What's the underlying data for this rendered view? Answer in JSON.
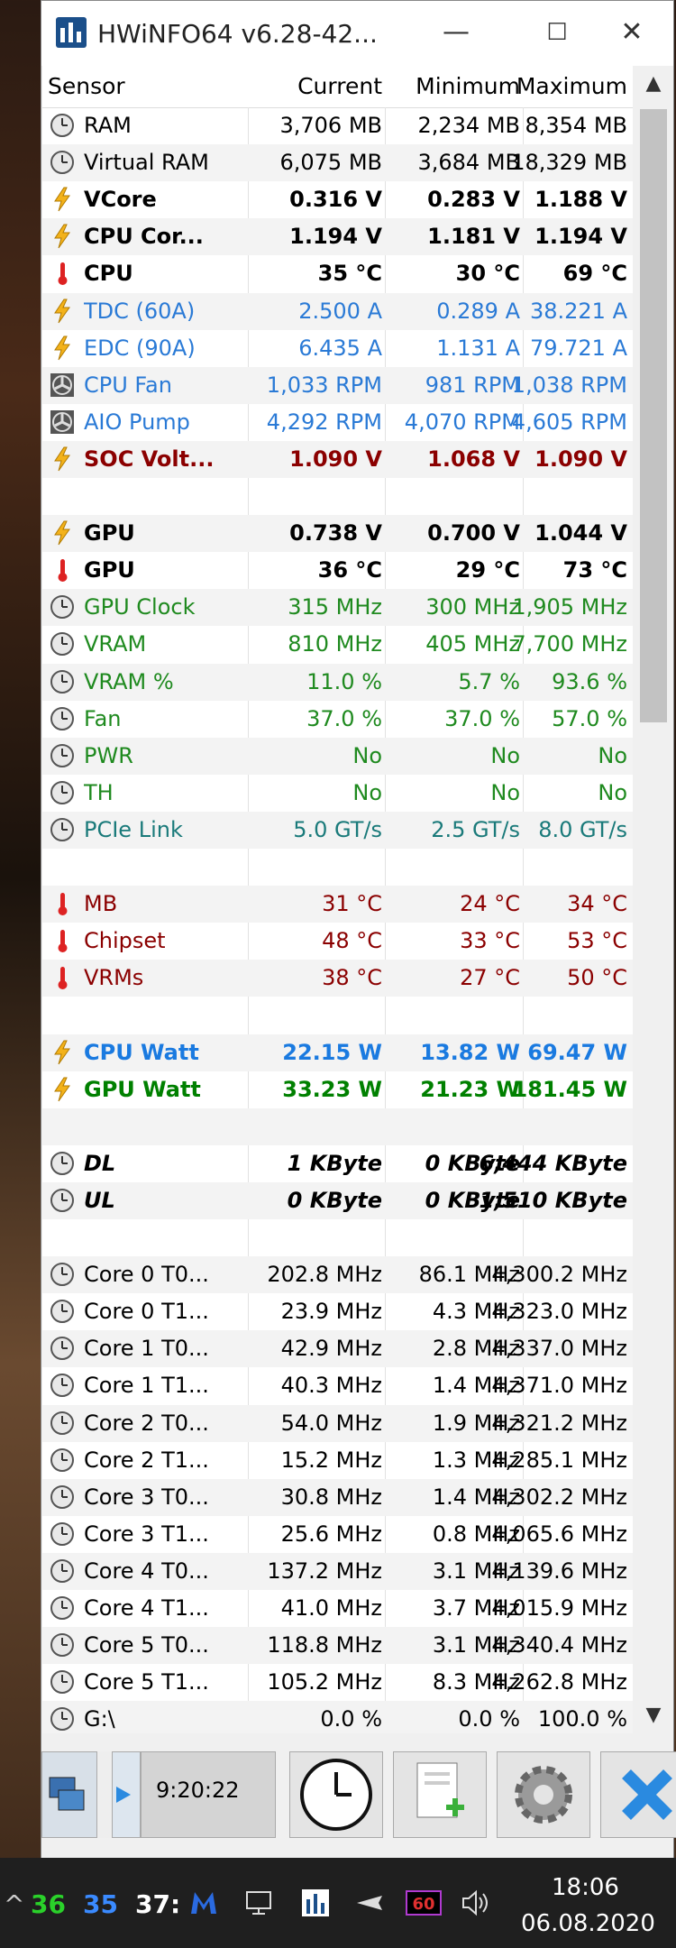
{
  "window": {
    "title": "HWiNFO64 v6.28-42...",
    "minimize": "—",
    "maximize": "☐",
    "close": "✕"
  },
  "header": {
    "sensor": "Sensor",
    "current": "Current",
    "minimum": "Minimum",
    "maximum": "Maximum"
  },
  "colors": {
    "blue": "#1a6fd6",
    "darkred": "#8b0000",
    "green": "#008000",
    "lightblue": "#2a8ae0",
    "teal": "#1a7a7a"
  },
  "rows": [
    {
      "name": "RAM",
      "cur": "3,706 MB",
      "min": "2,234 MB",
      "max": "8,354 MB",
      "icon": "clock-icon",
      "style": "",
      "color": "#000000"
    },
    {
      "name": "Virtual RAM",
      "cur": "6,075 MB",
      "min": "3,684 MB",
      "max": "18,329 MB",
      "icon": "clock-icon",
      "style": "",
      "color": "#000000"
    },
    {
      "name": "VCore",
      "cur": "0.316 V",
      "min": "0.283 V",
      "max": "1.188 V",
      "icon": "lightning-icon",
      "style": "bold",
      "color": "#000000"
    },
    {
      "name": "CPU Cor...",
      "cur": "1.194 V",
      "min": "1.181 V",
      "max": "1.194 V",
      "icon": "lightning-icon",
      "style": "bold",
      "color": "#000000"
    },
    {
      "name": "CPU",
      "cur": "35 °C",
      "min": "30 °C",
      "max": "69 °C",
      "icon": "thermometer-icon",
      "style": "bold",
      "color": "#000000"
    },
    {
      "name": "TDC (60A)",
      "cur": "2.500 A",
      "min": "0.289 A",
      "max": "38.221 A",
      "icon": "lightning-icon",
      "style": "",
      "color": "#2a7ad6"
    },
    {
      "name": "EDC (90A)",
      "cur": "6.435 A",
      "min": "1.131 A",
      "max": "79.721 A",
      "icon": "lightning-icon",
      "style": "",
      "color": "#2a7ad6"
    },
    {
      "name": "CPU Fan",
      "cur": "1,033 RPM",
      "min": "981 RPM",
      "max": "1,038 RPM",
      "icon": "fan-icon",
      "style": "",
      "color": "#2a7ad6"
    },
    {
      "name": "AIO Pump",
      "cur": "4,292 RPM",
      "min": "4,070 RPM",
      "max": "4,605 RPM",
      "icon": "fan-icon",
      "style": "",
      "color": "#2a7ad6"
    },
    {
      "name": "SOC Volt...",
      "cur": "1.090 V",
      "min": "1.068 V",
      "max": "1.090 V",
      "icon": "lightning-icon",
      "style": "bold",
      "color": "#8b0000"
    },
    {
      "name": "",
      "cur": "",
      "min": "",
      "max": "",
      "icon": "",
      "style": "",
      "color": "#000000"
    },
    {
      "name": "GPU",
      "cur": "0.738 V",
      "min": "0.700 V",
      "max": "1.044 V",
      "icon": "lightning-icon",
      "style": "bold",
      "color": "#000000"
    },
    {
      "name": "GPU",
      "cur": "36 °C",
      "min": "29 °C",
      "max": "73 °C",
      "icon": "thermometer-icon",
      "style": "bold",
      "color": "#000000"
    },
    {
      "name": "GPU Clock",
      "cur": "315 MHz",
      "min": "300 MHz",
      "max": "1,905 MHz",
      "icon": "clock-icon",
      "style": "",
      "color": "#1f8a1f"
    },
    {
      "name": "VRAM",
      "cur": "810 MHz",
      "min": "405 MHz",
      "max": "7,700 MHz",
      "icon": "clock-icon",
      "style": "",
      "color": "#1f8a1f"
    },
    {
      "name": "VRAM %",
      "cur": "11.0 %",
      "min": "5.7 %",
      "max": "93.6 %",
      "icon": "clock-icon",
      "style": "",
      "color": "#1f8a1f"
    },
    {
      "name": "Fan",
      "cur": "37.0 %",
      "min": "37.0 %",
      "max": "57.0 %",
      "icon": "clock-icon",
      "style": "",
      "color": "#1f8a1f"
    },
    {
      "name": "PWR",
      "cur": "No",
      "min": "No",
      "max": "No",
      "icon": "clock-icon",
      "style": "",
      "color": "#1f8a1f"
    },
    {
      "name": "TH",
      "cur": "No",
      "min": "No",
      "max": "No",
      "icon": "clock-icon",
      "style": "",
      "color": "#1f8a1f"
    },
    {
      "name": "PCIe Link",
      "cur": "5.0 GT/s",
      "min": "2.5 GT/s",
      "max": "8.0 GT/s",
      "icon": "clock-icon",
      "style": "",
      "color": "#1a7a7a"
    },
    {
      "name": "",
      "cur": "",
      "min": "",
      "max": "",
      "icon": "",
      "style": "",
      "color": "#000000"
    },
    {
      "name": "MB",
      "cur": "31 °C",
      "min": "24 °C",
      "max": "34 °C",
      "icon": "thermometer-icon",
      "style": "",
      "color": "#8b0000"
    },
    {
      "name": "Chipset",
      "cur": "48 °C",
      "min": "33 °C",
      "max": "53 °C",
      "icon": "thermometer-icon",
      "style": "",
      "color": "#8b0000"
    },
    {
      "name": "VRMs",
      "cur": "38 °C",
      "min": "27 °C",
      "max": "50 °C",
      "icon": "thermometer-icon",
      "style": "",
      "color": "#8b0000"
    },
    {
      "name": "",
      "cur": "",
      "min": "",
      "max": "",
      "icon": "",
      "style": "",
      "color": "#000000"
    },
    {
      "name": "CPU Watt",
      "cur": "22.15 W",
      "min": "13.82 W",
      "max": "69.47 W",
      "icon": "lightning-icon",
      "style": "bold",
      "color": "#1a7ae0"
    },
    {
      "name": "GPU Watt",
      "cur": "33.23 W",
      "min": "21.23 W",
      "max": "181.45 W",
      "icon": "lightning-icon",
      "style": "bold",
      "color": "#008000"
    },
    {
      "name": "",
      "cur": "",
      "min": "",
      "max": "",
      "icon": "",
      "style": "",
      "color": "#000000"
    },
    {
      "name": "DL",
      "cur": "1 KByte",
      "min": "0 KByte",
      "max": "6,444 KByte",
      "icon": "clock-icon",
      "style": "bolditalic",
      "color": "#000000"
    },
    {
      "name": "UL",
      "cur": "0 KByte",
      "min": "0 KByte",
      "max": "1,510 KByte",
      "icon": "clock-icon",
      "style": "bolditalic",
      "color": "#000000"
    },
    {
      "name": "",
      "cur": "",
      "min": "",
      "max": "",
      "icon": "",
      "style": "",
      "color": "#000000"
    },
    {
      "name": "Core 0 T0...",
      "cur": "202.8 MHz",
      "min": "86.1 MHz",
      "max": "4,300.2 MHz",
      "icon": "clock-icon",
      "style": "",
      "color": "#000000"
    },
    {
      "name": "Core 0 T1...",
      "cur": "23.9 MHz",
      "min": "4.3 MHz",
      "max": "4,323.0 MHz",
      "icon": "clock-icon",
      "style": "",
      "color": "#000000"
    },
    {
      "name": "Core 1 T0...",
      "cur": "42.9 MHz",
      "min": "2.8 MHz",
      "max": "4,337.0 MHz",
      "icon": "clock-icon",
      "style": "",
      "color": "#000000"
    },
    {
      "name": "Core 1 T1...",
      "cur": "40.3 MHz",
      "min": "1.4 MHz",
      "max": "4,371.0 MHz",
      "icon": "clock-icon",
      "style": "",
      "color": "#000000"
    },
    {
      "name": "Core 2 T0...",
      "cur": "54.0 MHz",
      "min": "1.9 MHz",
      "max": "4,321.2 MHz",
      "icon": "clock-icon",
      "style": "",
      "color": "#000000"
    },
    {
      "name": "Core 2 T1...",
      "cur": "15.2 MHz",
      "min": "1.3 MHz",
      "max": "4,285.1 MHz",
      "icon": "clock-icon",
      "style": "",
      "color": "#000000"
    },
    {
      "name": "Core 3 T0...",
      "cur": "30.8 MHz",
      "min": "1.4 MHz",
      "max": "4,302.2 MHz",
      "icon": "clock-icon",
      "style": "",
      "color": "#000000"
    },
    {
      "name": "Core 3 T1...",
      "cur": "25.6 MHz",
      "min": "0.8 MHz",
      "max": "4,065.6 MHz",
      "icon": "clock-icon",
      "style": "",
      "color": "#000000"
    },
    {
      "name": "Core 4 T0...",
      "cur": "137.2 MHz",
      "min": "3.1 MHz",
      "max": "4,139.6 MHz",
      "icon": "clock-icon",
      "style": "",
      "color": "#000000"
    },
    {
      "name": "Core 4 T1...",
      "cur": "41.0 MHz",
      "min": "3.7 MHz",
      "max": "4,015.9 MHz",
      "icon": "clock-icon",
      "style": "",
      "color": "#000000"
    },
    {
      "name": "Core 5 T0...",
      "cur": "118.8 MHz",
      "min": "3.1 MHz",
      "max": "4,340.4 MHz",
      "icon": "clock-icon",
      "style": "",
      "color": "#000000"
    },
    {
      "name": "Core 5 T1...",
      "cur": "105.2 MHz",
      "min": "8.3 MHz",
      "max": "4,262.8 MHz",
      "icon": "clock-icon",
      "style": "",
      "color": "#000000"
    },
    {
      "name": "G:\\",
      "cur": "0.0 %",
      "min": "0.0 %",
      "max": "100.0 %",
      "icon": "clock-icon",
      "style": "",
      "color": "#000000"
    }
  ],
  "toolbar": {
    "elapsed": "9:20:22"
  },
  "taskbar": {
    "chevron": "^",
    "tray1": "36",
    "tray1_color": "#2ad12a",
    "tray2": "35",
    "tray2_color": "#3a8aff",
    "tray3": "37:",
    "tray3_color": "#ffffff",
    "gpu_badge": "60",
    "time": "18:06",
    "date": "06.08.2020"
  }
}
